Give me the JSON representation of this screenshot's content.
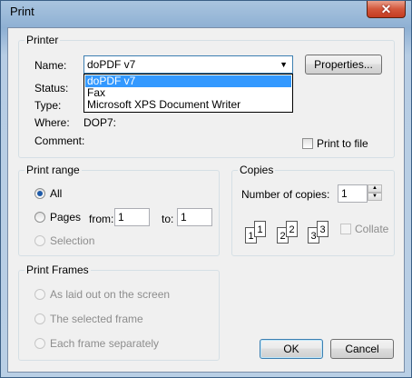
{
  "window": {
    "title": "Print",
    "close_glyph": "✕"
  },
  "printer": {
    "group_label": "Printer",
    "name_label": "Name:",
    "selected": "doPDF v7",
    "options": [
      "doPDF v7",
      "Fax",
      "Microsoft XPS Document Writer"
    ],
    "properties_label": "Properties...",
    "status_label": "Status:",
    "type_label": "Type:",
    "where_label": "Where:",
    "where_value": "DOP7:",
    "comment_label": "Comment:",
    "print_to_file_label": "Print to file"
  },
  "print_range": {
    "group_label": "Print range",
    "all_label": "All",
    "pages_label": "Pages",
    "from_label": "from:",
    "from_value": "1",
    "to_label": "to:",
    "to_value": "1",
    "selection_label": "Selection"
  },
  "copies": {
    "group_label": "Copies",
    "number_label": "Number of copies:",
    "number_value": "1",
    "collate_label": "Collate",
    "page_digits": [
      "1",
      "1",
      "2",
      "2",
      "3",
      "3"
    ]
  },
  "print_frames": {
    "group_label": "Print Frames",
    "option1": "As laid out on the screen",
    "option2": "The selected frame",
    "option3": "Each frame separately"
  },
  "buttons": {
    "ok": "OK",
    "cancel": "Cancel"
  }
}
